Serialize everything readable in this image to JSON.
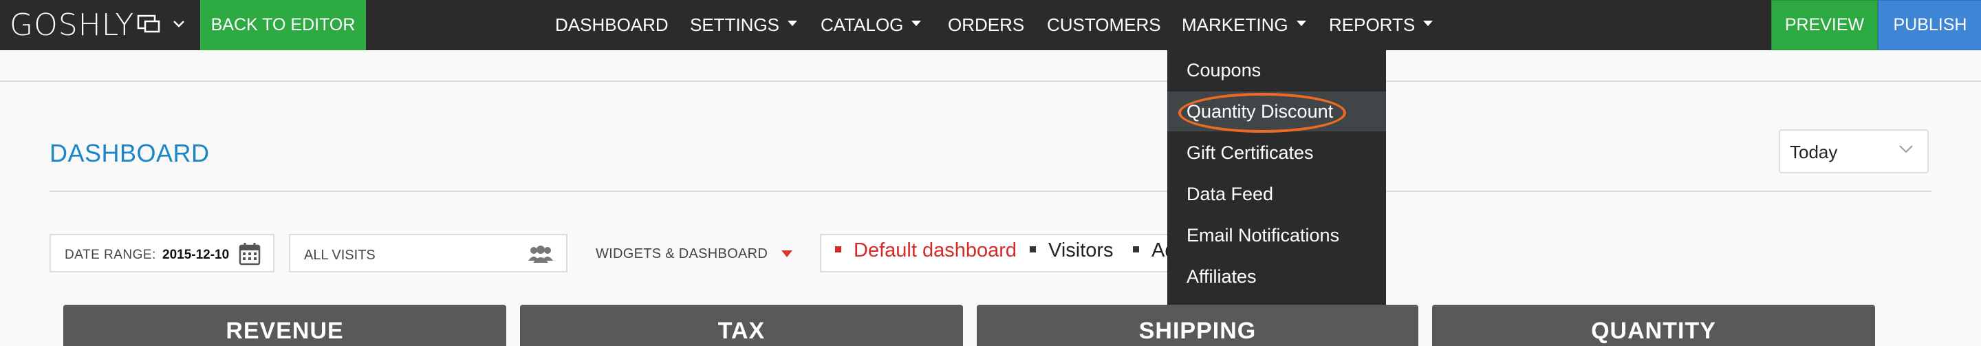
{
  "app": {
    "logo_text": "GOSHLY"
  },
  "topbar": {
    "back_to_editor": "BACK TO EDITOR",
    "nav": [
      {
        "label": "DASHBOARD",
        "has_caret": false
      },
      {
        "label": "SETTINGS",
        "has_caret": true
      },
      {
        "label": "CATALOG",
        "has_caret": true
      },
      {
        "label": "ORDERS",
        "has_caret": false
      },
      {
        "label": "CUSTOMERS",
        "has_caret": false
      },
      {
        "label": "MARKETING",
        "has_caret": true
      },
      {
        "label": "REPORTS",
        "has_caret": true
      }
    ],
    "preview": "PREVIEW",
    "publish": "PUBLISH"
  },
  "marketing_menu": {
    "items": [
      {
        "label": "Coupons"
      },
      {
        "label": "Quantity Discount",
        "active": true,
        "highlighted": true
      },
      {
        "label": "Gift Certificates"
      },
      {
        "label": "Data Feed"
      },
      {
        "label": "Email Notifications"
      },
      {
        "label": "Affiliates"
      }
    ]
  },
  "dashboard": {
    "title": "DASHBOARD",
    "period": {
      "selected": "Today"
    },
    "filters": {
      "date_range_label": "DATE RANGE:",
      "date_range_value": "2015-12-10",
      "visits": "ALL VISITS",
      "widgets_dashboard": "WIDGETS & DASHBOARD"
    },
    "tabs": [
      {
        "label": "Default dashboard",
        "active": true
      },
      {
        "label": "Visitors",
        "active": false
      },
      {
        "label": "Ad",
        "active": false
      }
    ],
    "widgets": [
      "REVENUE",
      "TAX",
      "SHIPPING",
      "QUANTITY"
    ]
  },
  "colors": {
    "topbar_bg": "#2b2b2b",
    "green": "#2dab42",
    "blue": "#3e85d6",
    "title_blue": "#1a86c8",
    "active_tab_red": "#d42a2a",
    "highlight_orange": "#ee6a22",
    "card_header": "#595959"
  }
}
